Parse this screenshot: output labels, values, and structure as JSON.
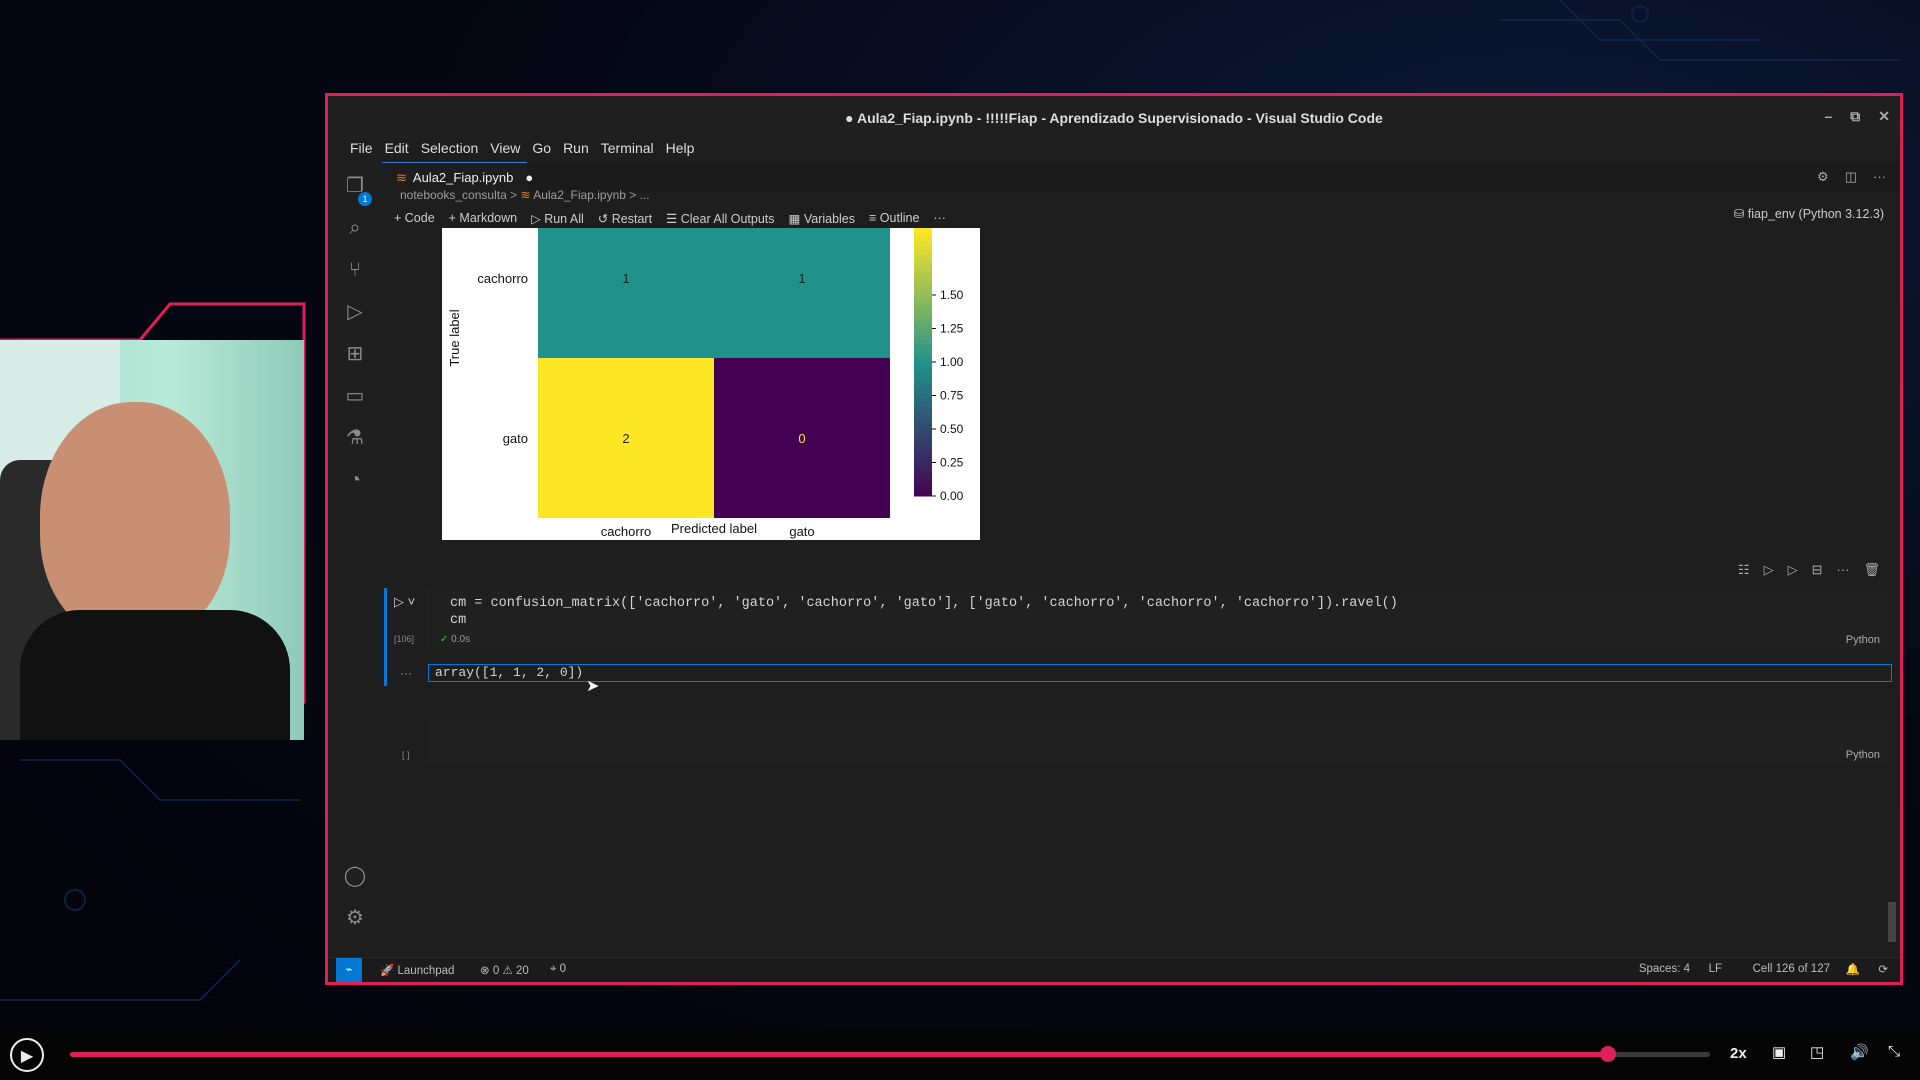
{
  "window": {
    "title": "● Aula2_Fiap.ipynb - !!!!!Fiap - Aprendizado Supervisionado - Visual Studio Code",
    "controls": [
      "–",
      "⧉",
      "✕"
    ]
  },
  "menu": [
    "File",
    "Edit",
    "Selection",
    "View",
    "Go",
    "Run",
    "Terminal",
    "Help"
  ],
  "activity_badge": "1",
  "tab": {
    "label": "Aula2_Fiap.ipynb",
    "dirty": "●"
  },
  "breadcrumb": [
    "notebooks_consulta",
    ">",
    "Aula2_Fiap.ipynb",
    ">",
    "..."
  ],
  "toolbar": {
    "code": "+ Code",
    "markdown": "+ Markdown",
    "run_all": "Run All",
    "restart": "Restart",
    "clear": "Clear All Outputs",
    "variables": "Variables",
    "outline": "Outline",
    "more": "···"
  },
  "kernel": "fiap_env (Python 3.12.3)",
  "chart_data": {
    "type": "heatmap",
    "rows": [
      "cachorro",
      "gato"
    ],
    "cols": [
      "cachorro",
      "gato"
    ],
    "values": [
      [
        1,
        1
      ],
      [
        2,
        0
      ]
    ],
    "xlabel": "Predicted label",
    "ylabel": "True label",
    "colorbar_ticks": [
      "1.50",
      "1.25",
      "1.00",
      "0.75",
      "0.50",
      "0.25",
      "0.00"
    ],
    "colormap": "viridis",
    "colors": {
      "low": "#440154",
      "mid": "#21918c",
      "high": "#fde725"
    }
  },
  "cell1": {
    "code_line1": "cm = confusion_matrix(['cachorro', 'gato', 'cachorro', 'gato'], ['gato', 'cachorro', 'cachorro', 'cachorro']).ravel()",
    "code_line2": "cm",
    "exec_count": "[106]",
    "time": "0.0s",
    "lang": "Python",
    "output": "array([1, 1, 2, 0])",
    "more": "···"
  },
  "cell2": {
    "exec_count": "[ ]",
    "lang": "Python"
  },
  "status": {
    "remote": "⌁",
    "launchpad": "Launchpad",
    "errors": "0",
    "warnings": "20",
    "ports": "0",
    "spaces": "Spaces: 4",
    "eol": "LF",
    "cell": "Cell 126 of 127"
  },
  "player": {
    "speed": "2x",
    "progress": 0.938
  }
}
